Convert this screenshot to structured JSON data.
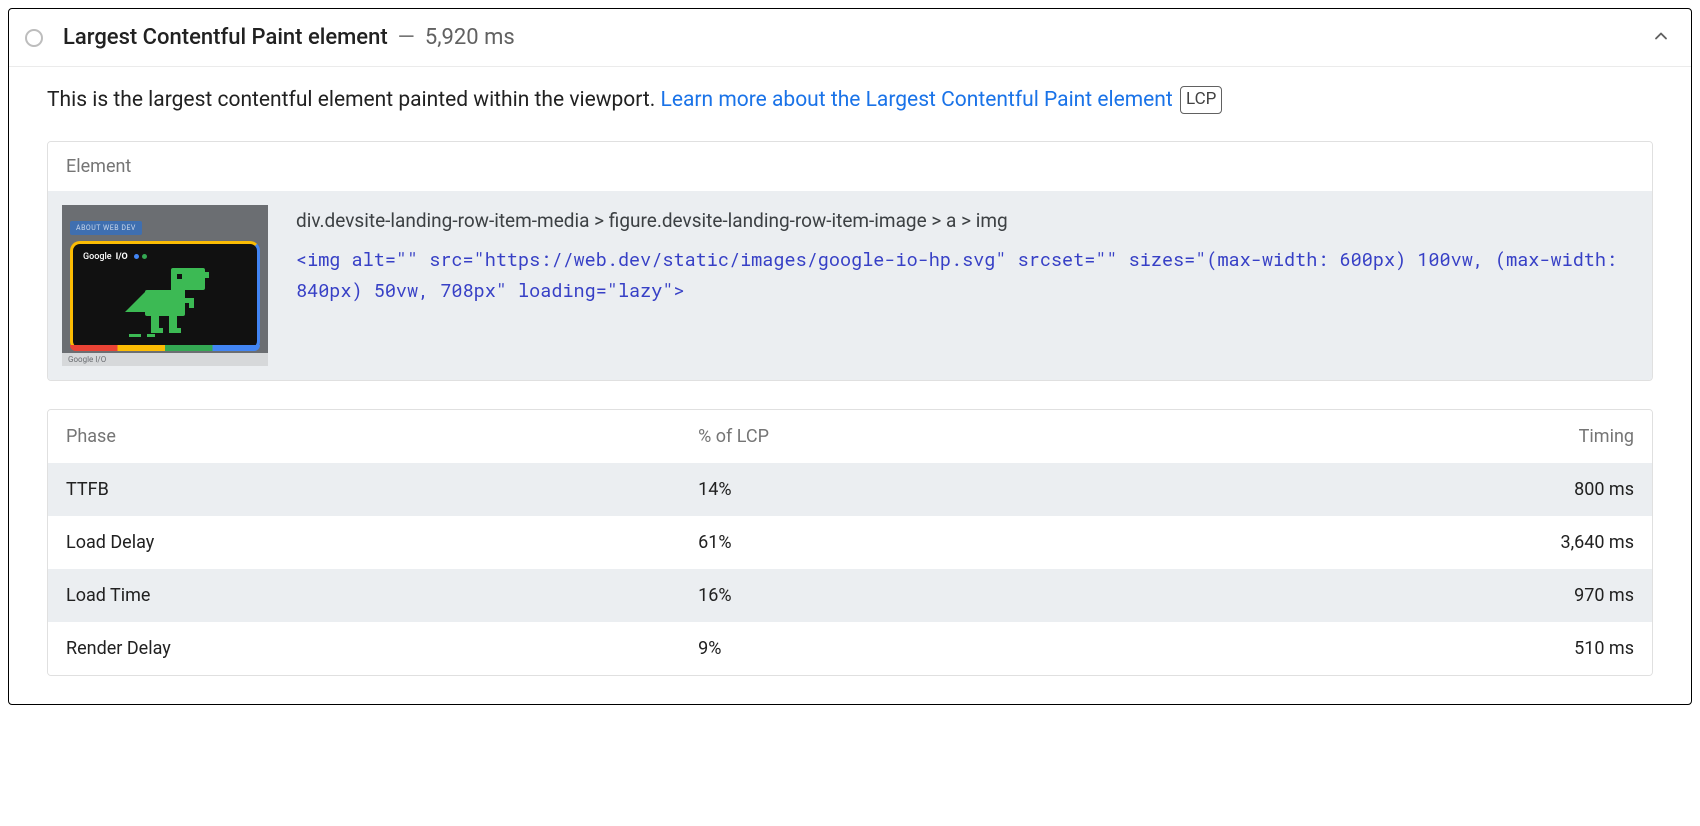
{
  "audit": {
    "title": "Largest Contentful Paint element",
    "dash": "—",
    "timing": "5,920 ms",
    "description_prefix": "This is the largest contentful element painted within the viewport. ",
    "learn_more": "Learn more about the Largest Contentful Paint element",
    "badge": "LCP"
  },
  "element_section": {
    "header": "Element",
    "selector_path": "div.devsite-landing-row-item-media > figure.devsite-landing-row-item-image > a > img",
    "code_snippet": "<img alt=\"\" src=\"https://web.dev/static/images/google-io-hp.svg\" srcset=\"\" sizes=\"(max-width: 600px) 100vw, (max-width: 840px) 50vw, 708px\" loading=\"lazy\">",
    "thumb": {
      "button_label": "ABOUT WEB DEV",
      "brand": "Google",
      "io_text": "I/O",
      "caption_left": "Google I/O"
    }
  },
  "phase_table": {
    "columns": {
      "phase": "Phase",
      "pct": "% of LCP",
      "timing": "Timing"
    },
    "rows": [
      {
        "phase": "TTFB",
        "pct": "14%",
        "timing": "800 ms"
      },
      {
        "phase": "Load Delay",
        "pct": "61%",
        "timing": "3,640 ms"
      },
      {
        "phase": "Load Time",
        "pct": "16%",
        "timing": "970 ms"
      },
      {
        "phase": "Render Delay",
        "pct": "9%",
        "timing": "510 ms"
      }
    ]
  }
}
